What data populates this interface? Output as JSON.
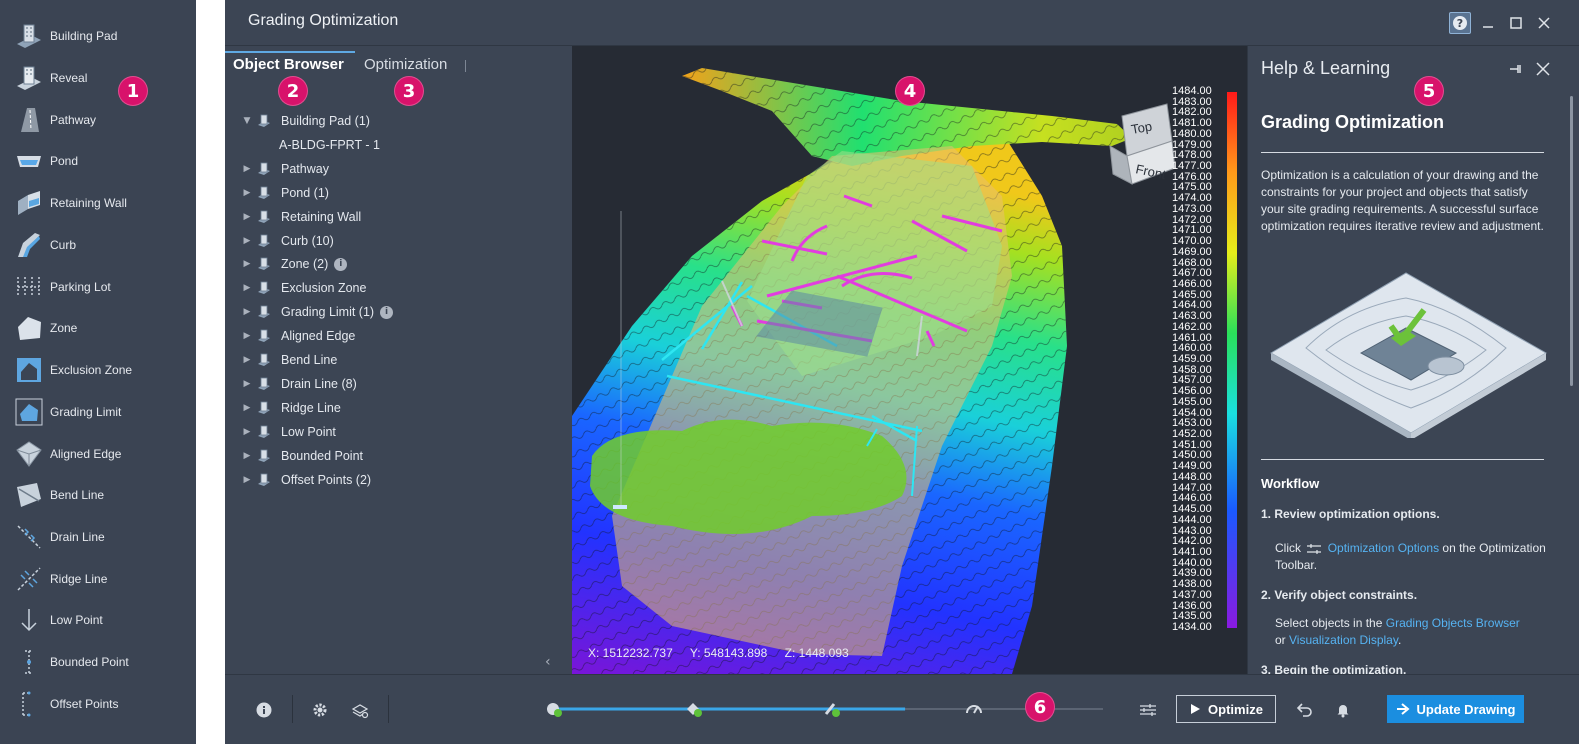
{
  "palette": {
    "items": [
      {
        "label": "Building Pad",
        "icon": "building-pad-icon"
      },
      {
        "label": "Reveal",
        "icon": "reveal-icon"
      },
      {
        "label": "Pathway",
        "icon": "pathway-icon"
      },
      {
        "label": "Pond",
        "icon": "pond-icon"
      },
      {
        "label": "Retaining Wall",
        "icon": "retaining-wall-icon"
      },
      {
        "label": "Curb",
        "icon": "curb-icon"
      },
      {
        "label": "Parking Lot",
        "icon": "parking-lot-icon"
      },
      {
        "label": "Zone",
        "icon": "zone-icon"
      },
      {
        "label": "Exclusion Zone",
        "icon": "exclusion-zone-icon"
      },
      {
        "label": "Grading Limit",
        "icon": "grading-limit-icon"
      },
      {
        "label": "Aligned Edge",
        "icon": "aligned-edge-icon"
      },
      {
        "label": "Bend Line",
        "icon": "bend-line-icon"
      },
      {
        "label": "Drain Line",
        "icon": "drain-line-icon"
      },
      {
        "label": "Ridge Line",
        "icon": "ridge-line-icon"
      },
      {
        "label": "Low Point",
        "icon": "low-point-icon"
      },
      {
        "label": "Bounded Point",
        "icon": "bounded-point-icon"
      },
      {
        "label": "Offset Points",
        "icon": "offset-points-icon"
      }
    ]
  },
  "callouts": [
    "1",
    "2",
    "3",
    "4",
    "5",
    "6"
  ],
  "window": {
    "title": "Grading Optimization",
    "help_icon": "question-icon",
    "minimize_icon": "minimize-icon",
    "maximize_icon": "maximize-icon",
    "close_icon": "close-icon"
  },
  "tabs": {
    "object_browser": "Object Browser",
    "optimization": "Optimization"
  },
  "tree": [
    {
      "label": "Building Pad (1)",
      "arrow": "▼",
      "info": false
    },
    {
      "label": "A-BLDG-FPRT - 1",
      "arrow": "",
      "info": false,
      "child": true
    },
    {
      "label": "Pathway",
      "arrow": "▶",
      "info": false
    },
    {
      "label": "Pond (1)",
      "arrow": "▶",
      "info": false
    },
    {
      "label": "Retaining Wall",
      "arrow": "▶",
      "info": false
    },
    {
      "label": "Curb (10)",
      "arrow": "▶",
      "info": false
    },
    {
      "label": "Zone (2)",
      "arrow": "▶",
      "info": true
    },
    {
      "label": "Exclusion Zone",
      "arrow": "▶",
      "info": false
    },
    {
      "label": "Grading Limit (1)",
      "arrow": "▶",
      "info": true
    },
    {
      "label": "Aligned Edge",
      "arrow": "▶",
      "info": false
    },
    {
      "label": "Bend Line",
      "arrow": "▶",
      "info": false
    },
    {
      "label": "Drain Line (8)",
      "arrow": "▶",
      "info": false
    },
    {
      "label": "Ridge Line",
      "arrow": "▶",
      "info": false
    },
    {
      "label": "Low Point",
      "arrow": "▶",
      "info": false
    },
    {
      "label": "Bounded Point",
      "arrow": "▶",
      "info": false
    },
    {
      "label": "Offset Points (2)",
      "arrow": "▶",
      "info": false
    }
  ],
  "viewport": {
    "coords": {
      "x": "X: 1512232.737",
      "y": "Y: 548143.898",
      "z": "Z: 1448.093"
    },
    "viewcube": {
      "top": "Top",
      "front": "Front"
    },
    "scale_labels": [
      "1484.00",
      "1483.00",
      "1482.00",
      "1481.00",
      "1480.00",
      "1479.00",
      "1478.00",
      "1477.00",
      "1476.00",
      "1475.00",
      "1474.00",
      "1473.00",
      "1472.00",
      "1471.00",
      "1470.00",
      "1469.00",
      "1468.00",
      "1467.00",
      "1466.00",
      "1465.00",
      "1464.00",
      "1463.00",
      "1462.00",
      "1461.00",
      "1460.00",
      "1459.00",
      "1458.00",
      "1457.00",
      "1456.00",
      "1455.00",
      "1454.00",
      "1453.00",
      "1452.00",
      "1451.00",
      "1450.00",
      "1449.00",
      "1448.00",
      "1447.00",
      "1446.00",
      "1445.00",
      "1444.00",
      "1443.00",
      "1442.00",
      "1441.00",
      "1440.00",
      "1439.00",
      "1438.00",
      "1437.00",
      "1436.00",
      "1435.00",
      "1434.00"
    ]
  },
  "help": {
    "panel_title": "Help & Learning",
    "heading": "Grading Optimization",
    "intro": "Optimization is a calculation of your drawing and the constraints for your project and objects that satisfy your site grading requirements. A successful surface optimization requires iterative review and adjustment.",
    "workflow": "Workflow",
    "step1_title": "1. Review optimization options.",
    "step1_click": "Click",
    "step1_link": "Optimization Options",
    "step1_rest": " on the Optimization Toolbar.",
    "step2_title": "2. Verify object constraints.",
    "step2_text": "Select objects in the ",
    "step2_link1": "Grading Objects Browser",
    "step2_or": "or ",
    "step2_link2": "Visualization Display",
    "step2_end": ".",
    "step3_title": "3. Begin the optimization."
  },
  "toolbar": {
    "optimize_label": "Optimize",
    "update_label": "Update Drawing",
    "progress": 0.85
  },
  "colors": {
    "accent": "#1b8ee0",
    "callout": "#d8126b",
    "link": "#56b3f2"
  }
}
